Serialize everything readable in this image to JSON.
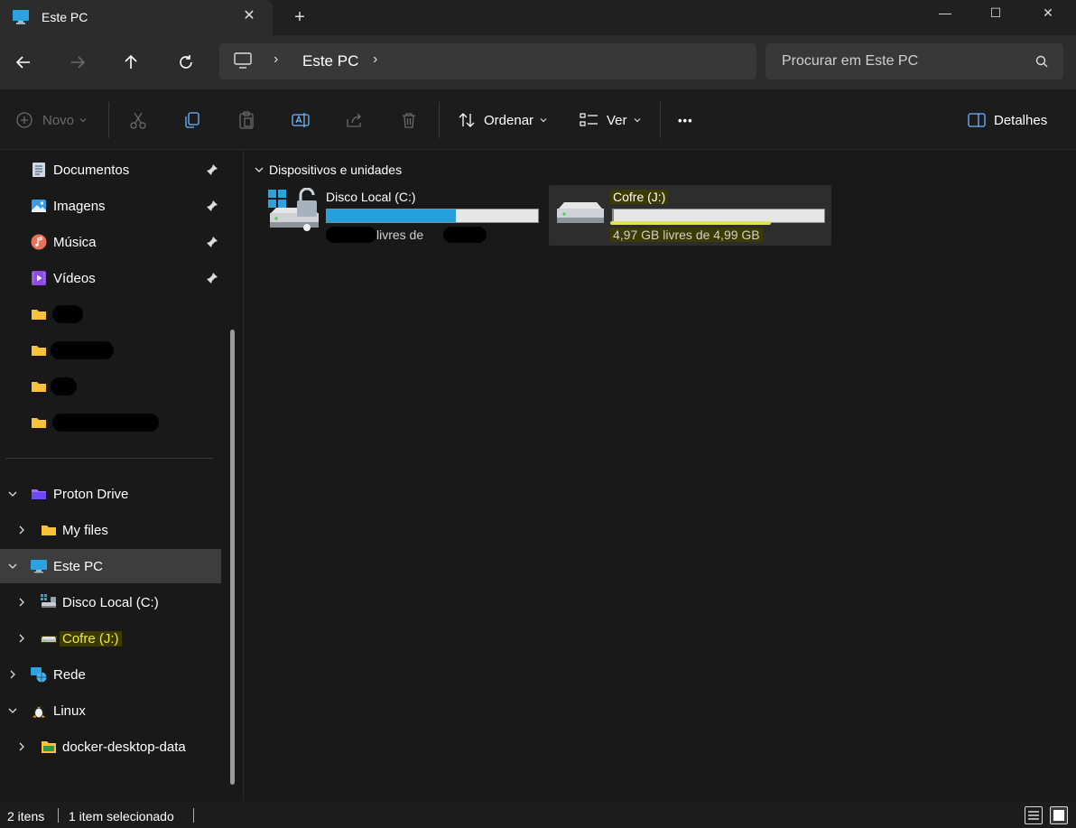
{
  "window": {
    "tab_title": "Este PC",
    "tab_close": "✕",
    "new_tab": "+",
    "minimize": "—",
    "maximize": "☐",
    "close": "✕"
  },
  "nav": {
    "address_text": "Este PC",
    "address_sep": "›",
    "search_placeholder": "Procurar em Este PC"
  },
  "toolbar": {
    "new_label": "Novo",
    "sort_label": "Ordenar",
    "view_label": "Ver",
    "more_label": "•••",
    "details_label": "Detalhes"
  },
  "sidebar": {
    "pinned": [
      {
        "label": "Documentos",
        "icon": "documents-icon"
      },
      {
        "label": "Imagens",
        "icon": "pictures-icon"
      },
      {
        "label": "Música",
        "icon": "music-icon"
      },
      {
        "label": "Vídeos",
        "icon": "videos-icon"
      }
    ],
    "tree": [
      {
        "label": "Proton Drive",
        "icon": "proton-drive-icon",
        "expanded": true
      },
      {
        "label": "My files",
        "icon": "folder-icon"
      },
      {
        "label": "Este PC",
        "icon": "pc-icon",
        "expanded": true,
        "selected": true
      },
      {
        "label": "Disco Local (C:)",
        "icon": "local-disk-icon"
      },
      {
        "label": "Cofre (J:)",
        "icon": "drive-icon"
      },
      {
        "label": "Rede",
        "icon": "network-icon"
      },
      {
        "label": "Linux",
        "icon": "linux-icon",
        "expanded": true
      },
      {
        "label": "docker-desktop-data",
        "icon": "folder-icon"
      }
    ]
  },
  "content": {
    "group_header": "Dispositivos e unidades",
    "drives": [
      {
        "name": "Disco Local (C:)",
        "free_text": "livres de",
        "used_fraction": 0.61
      },
      {
        "name": "Cofre (J:)",
        "free_text": "4,97 GB livres de 4,99 GB",
        "used_fraction": 0.004
      }
    ]
  },
  "status": {
    "items": "2 itens",
    "selected": "1 item selecionado"
  },
  "colors": {
    "accent": "#26a0da",
    "highlight": "#f0e84a",
    "folder": "#f8c33a"
  }
}
